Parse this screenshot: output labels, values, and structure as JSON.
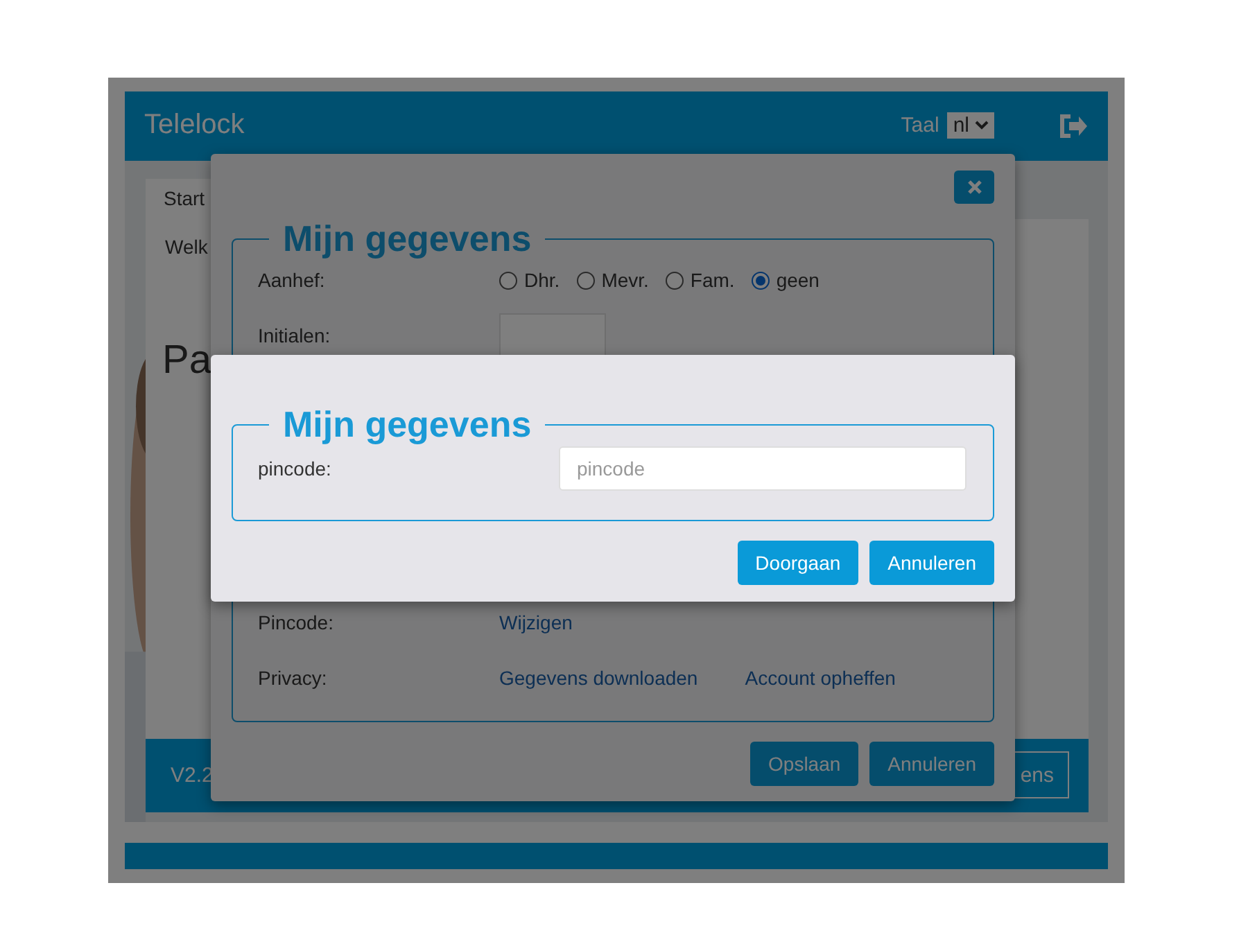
{
  "app": {
    "title": "Telelock",
    "language_label": "Taal",
    "language": "nl",
    "tab": "Start",
    "welcome": "Welk",
    "heading": "Pa",
    "version": "V2.2",
    "footer_button": "ens"
  },
  "profile_dialog": {
    "legend": "Mijn gegevens",
    "salutation": {
      "label": "Aanhef:",
      "options": [
        {
          "label": "Dhr.",
          "selected": false
        },
        {
          "label": "Mevr.",
          "selected": false
        },
        {
          "label": "Fam.",
          "selected": false
        },
        {
          "label": "geen",
          "selected": true
        }
      ]
    },
    "initials": {
      "label": "Initialen:"
    },
    "pincode": {
      "label": "Pincode:",
      "link": "Wijzigen"
    },
    "privacy": {
      "label": "Privacy:",
      "links": [
        "Gegevens downloaden",
        "Account opheffen"
      ]
    },
    "buttons": [
      "Opslaan",
      "Annuleren"
    ]
  },
  "pincode_dialog": {
    "legend": "Mijn gegevens",
    "field": {
      "label": "pincode:",
      "placeholder": "pincode"
    },
    "buttons": [
      "Doorgaan",
      "Annuleren"
    ]
  }
}
